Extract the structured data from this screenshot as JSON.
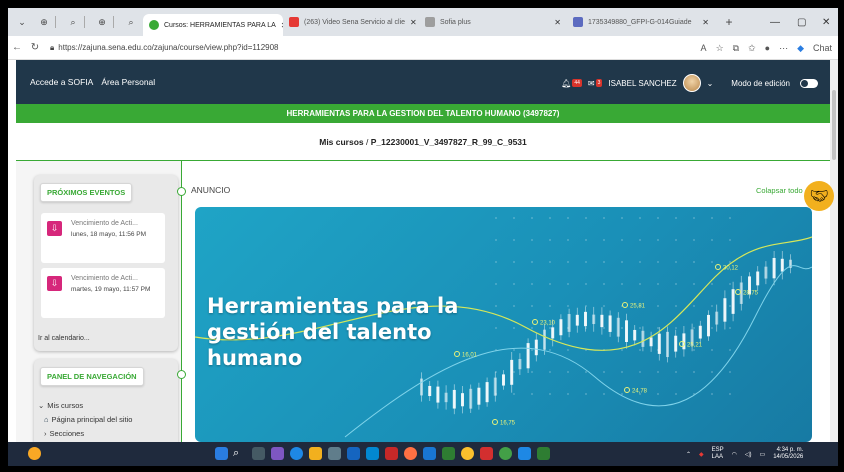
{
  "browser": {
    "tabs": [
      {
        "label": "Cursos: HERRAMIENTAS PARA LA",
        "active": true
      },
      {
        "label": "(263) Video Sena Servicio al clie"
      },
      {
        "label": "Sofia plus"
      },
      {
        "label": "1735349880_GFPI-G-014Guiade"
      }
    ],
    "url": "https://zajuna.sena.edu.co/zajuna/course/view.php?id=112908",
    "chat_label": "Chat"
  },
  "site": {
    "nav": [
      "Accede a SOFIA",
      "Área Personal"
    ],
    "notif_count": "44",
    "msg_count": "3",
    "user_name": "ISABEL SANCHEZ",
    "edit_mode_label": "Modo de edición",
    "course_title": "HERRAMIENTAS PARA LA GESTION DEL TALENTO HUMANO (3497827)",
    "breadcrumb": {
      "root": "Mis cursos",
      "sep": "/",
      "course": "P_12230001_V_3497827_R_99_C_9531"
    }
  },
  "events_block": {
    "title": "PRÓXIMOS EVENTOS",
    "events": [
      {
        "title": "Vencimiento de Acti...",
        "date": "lunes, 18 mayo, 11:56 PM"
      },
      {
        "title": "Vencimiento de Acti...",
        "date": "martes, 19 mayo, 11:57 PM"
      }
    ],
    "calendar_link": "Ir al calendario..."
  },
  "nav_block": {
    "title": "PANEL DE NAVEGACIÓN",
    "items": [
      "Mis cursos",
      "Página principal del sitio",
      "Secciones"
    ]
  },
  "main": {
    "section_label": "ANUNCIO",
    "collapse_label": "Colapsar todo",
    "banner_title_lines": [
      "Herramientas para la",
      "gestión del talento",
      "humano"
    ],
    "chart_labels": [
      "23,10",
      "25,81",
      "16,01",
      "25,21",
      "24,78",
      "16,75",
      "30,12",
      "28,75"
    ]
  },
  "taskbar": {
    "lang": "ESP",
    "lang_sub": "LAA",
    "time": "4:34 p. m.",
    "date": "14/05/2026"
  }
}
